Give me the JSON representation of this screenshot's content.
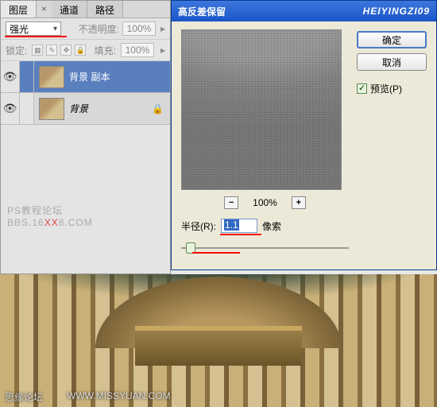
{
  "panel": {
    "tabs": [
      "图层",
      "通道",
      "路径"
    ],
    "tab_close": "×",
    "blend_mode": "强光",
    "opacity_label": "不透明度:",
    "opacity_value": "100%",
    "lock_label": "锁定:",
    "fill_label": "填充:",
    "fill_value": "100%",
    "layers": [
      {
        "name": "背景 副本",
        "selected": true
      },
      {
        "name": "背景",
        "selected": false,
        "locked": true
      }
    ]
  },
  "watermark": {
    "line1": "PS教程论坛",
    "line2_a": "BBS.16",
    "line2_xx": "XX",
    "line2_b": "8.COM"
  },
  "dialog": {
    "title": "高反差保留",
    "brand": "HEIYINGZI09",
    "zoom_value": "100%",
    "zoom_minus": "−",
    "zoom_plus": "+",
    "radius_label": "半径(R):",
    "radius_value": "1.1",
    "radius_unit": "像索",
    "ok": "确定",
    "cancel": "取消",
    "preview_label": "预览(P)"
  },
  "footer": {
    "left": "思缘论坛",
    "right": "WWW.MISSYUAN.COM"
  }
}
